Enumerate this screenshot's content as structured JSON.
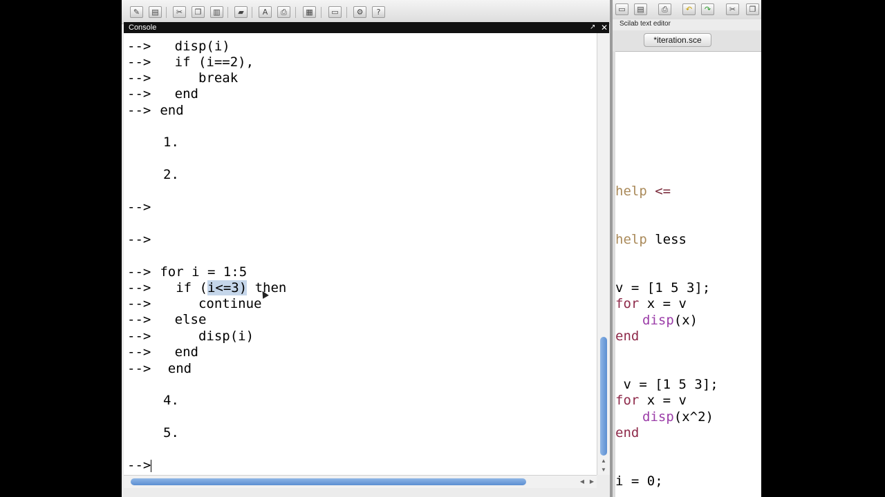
{
  "console": {
    "title": "Console",
    "undock_glyph": "↗",
    "close_glyph": "✕",
    "lines": [
      {
        "prompt": "-->",
        "code": "   disp(i)"
      },
      {
        "prompt": "-->",
        "code": "   if (i==2),"
      },
      {
        "prompt": "-->",
        "code": "      break"
      },
      {
        "prompt": "-->",
        "code": "   end"
      },
      {
        "prompt": "-->",
        "code": "end"
      },
      {
        "prompt": "",
        "code": "1."
      },
      {
        "prompt": "",
        "code": "2."
      },
      {
        "prompt": "-->",
        "code": ""
      },
      {
        "prompt": "-->",
        "code": ""
      },
      {
        "prompt": "-->",
        "code": "for i = 1:5"
      },
      {
        "prompt": "-->",
        "code_pre": "  if (",
        "code_hl": "i<=3)",
        "code_post": " then"
      },
      {
        "prompt": "-->",
        "code": "      continue"
      },
      {
        "prompt": "-->",
        "code": "   else"
      },
      {
        "prompt": "-->",
        "code": "      disp(i)"
      },
      {
        "prompt": "-->",
        "code": "   end"
      },
      {
        "prompt": "-->",
        "code": " end"
      },
      {
        "prompt": "",
        "code": "4."
      },
      {
        "prompt": "",
        "code": "5."
      },
      {
        "prompt": "-->",
        "code": ""
      }
    ]
  },
  "editor": {
    "window_title": "Scilab text editor",
    "tab_label": "*iteration.sce",
    "code": {
      "l1_kw": "help",
      "l1_rest": " <=",
      "l2_kw": "help",
      "l2_rest": " less",
      "l3": "v = [1 5 3];",
      "l4_kw": "for",
      "l4_rest": " x = v",
      "l5_fn": "disp",
      "l5_rest": "(x)",
      "l6_kw": "end",
      "l7": " v = [1 5 3];",
      "l8_kw": "for",
      "l8_rest": " x = v",
      "l9_fn": "disp",
      "l9_rest": "(x^2)",
      "l10_kw": "end",
      "l11": "i = 0;"
    }
  },
  "toolbar_icons": [
    "new-file-icon",
    "open-file-icon",
    "cut-icon",
    "copy-icon",
    "paste-icon",
    "folder-icon",
    "font-icon",
    "print-icon",
    "variable-browser-icon",
    "preferences-icon",
    "settings-icon",
    "help-icon"
  ],
  "toolbar_glyphs": [
    "✎",
    "▤",
    "✂",
    "❐",
    "▥",
    "▰",
    "A",
    "⎙",
    "▦",
    "▭",
    "⚙",
    "?"
  ],
  "editor_toolbar_glyphs": [
    "▭",
    "▤",
    "⎙",
    "↶",
    "↷",
    "✂",
    "❐"
  ]
}
